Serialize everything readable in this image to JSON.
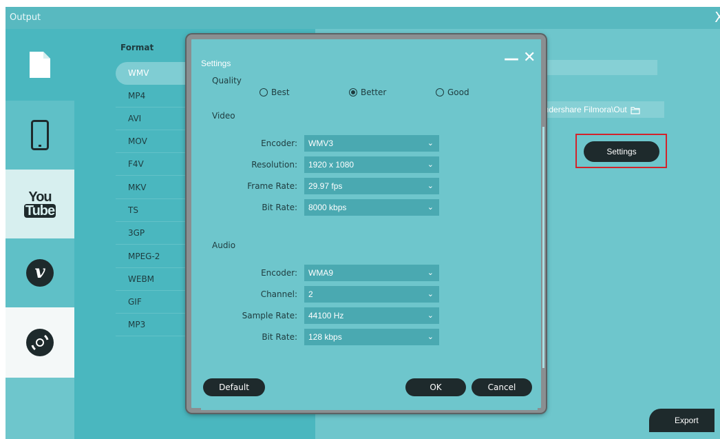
{
  "window": {
    "title": "Output",
    "close_glyph": "X"
  },
  "categories": [
    {
      "name": "file-icon"
    },
    {
      "name": "phone-icon"
    },
    {
      "name": "youtube-icon",
      "text_top": "You",
      "text_bottom": "Tube"
    },
    {
      "name": "vimeo-icon",
      "glyph": "v"
    },
    {
      "name": "dvd-icon"
    }
  ],
  "format": {
    "heading": "Format",
    "items": [
      "WMV",
      "MP4",
      "AVI",
      "MOV",
      "F4V",
      "MKV",
      "TS",
      "3GP",
      "MPEG-2",
      "WEBM",
      "GIF",
      "MP3"
    ],
    "selected": "WMV"
  },
  "output": {
    "path_value": "ondershare Filmora\\Out",
    "settings_label": "Settings",
    "export_label": "Export"
  },
  "dialog": {
    "title": "Settings",
    "min_glyph": "—",
    "close_glyph": "✕",
    "quality": {
      "label": "Quality",
      "options": [
        "Best",
        "Better",
        "Good"
      ],
      "selected": "Better"
    },
    "video": {
      "heading": "Video",
      "encoder_label": "Encoder:",
      "encoder": "WMV3",
      "resolution_label": "Resolution:",
      "resolution": "1920 x 1080",
      "frame_rate_label": "Frame Rate:",
      "frame_rate": "29.97 fps",
      "bit_rate_label": "Bit Rate:",
      "bit_rate": "8000 kbps"
    },
    "audio": {
      "heading": "Audio",
      "encoder_label": "Encoder:",
      "encoder": "WMA9",
      "channel_label": "Channel:",
      "channel": "2",
      "sample_rate_label": "Sample Rate:",
      "sample_rate": "44100 Hz",
      "bit_rate_label": "Bit Rate:",
      "bit_rate": "128 kbps"
    },
    "buttons": {
      "default": "Default",
      "ok": "OK",
      "cancel": "Cancel"
    }
  },
  "colors": {
    "accent": "#6ec6cc",
    "dark_button": "#1e2a2c",
    "highlight": "#d3232a"
  }
}
